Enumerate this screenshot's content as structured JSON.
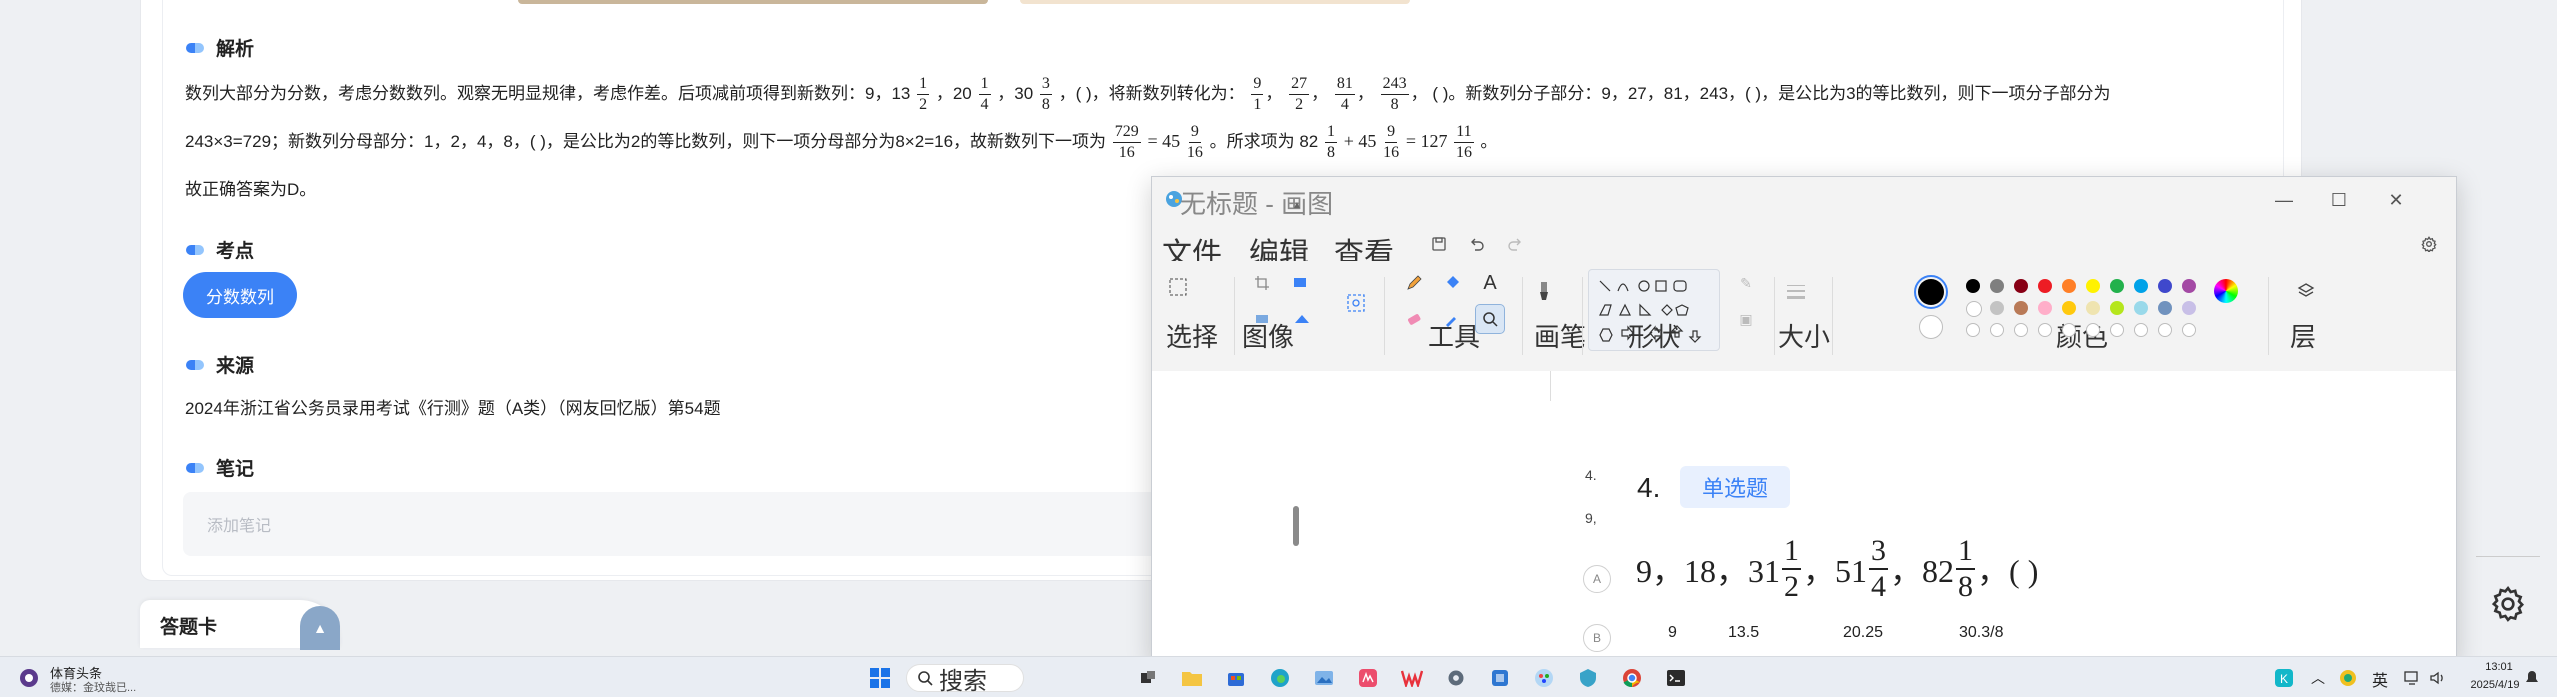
{
  "page": {
    "analysis_title": "解析",
    "analysis_line1_a": "数列大部分为分数，考虑分数数列。观察无明显规律，考虑作差。后项减前项得到新数列：9，13",
    "analysis_line1_b": "，20",
    "analysis_line1_c": "，30",
    "analysis_line1_d": "，( )，将新数列转化为：",
    "analysis_line1_e": "( )。新数列分子部分：9，27，81，243，( )，是公比为3的等比数列，则下一项分子部分为",
    "fracs_line1": [
      {
        "n": "1",
        "d": "2"
      },
      {
        "n": "1",
        "d": "4"
      },
      {
        "n": "3",
        "d": "8"
      },
      {
        "n": "9",
        "d": "1"
      },
      {
        "n": "27",
        "d": "2"
      },
      {
        "n": "81",
        "d": "4"
      },
      {
        "n": "243",
        "d": "8"
      }
    ],
    "analysis_line2_a": "243×3=729；新数列分母部分：1，2，4，8，( )，是公比为2的等比数列，则下一项分母部分为8×2=16，故新数列下一项为",
    "analysis_line2_b": "= 45",
    "analysis_line2_c": "。所求项为 82",
    "analysis_line2_d": "+ 45",
    "analysis_line2_e": "= 127",
    "analysis_line2_f": "。",
    "fracs_line2": [
      {
        "n": "729",
        "d": "16"
      },
      {
        "n": "9",
        "d": "16"
      },
      {
        "n": "1",
        "d": "8"
      },
      {
        "n": "9",
        "d": "16"
      },
      {
        "n": "11",
        "d": "16"
      }
    ],
    "analysis_line3": "故正确答案为D。",
    "knowledge_title": "考点",
    "knowledge_tag": "分数数列",
    "source_title": "来源",
    "source_text": "2024年浙江省公务员录用考试《行测》题（A类）（网友回忆版）第54题",
    "notes_title": "笔记",
    "notes_placeholder": "添加笔记",
    "answer_card": "答题卡"
  },
  "paint": {
    "title": "无标题 - 画图",
    "menu": [
      "文件",
      "编辑",
      "查看"
    ],
    "groups": [
      "选择",
      "图像",
      "工具",
      "画笔",
      "形状",
      "大小",
      "颜色",
      "层"
    ],
    "palette_row1": [
      "#000000",
      "#7f7f7f",
      "#880015",
      "#ed1c24",
      "#ff7f27",
      "#fff200",
      "#22b14c",
      "#00a2e8",
      "#3f48cc",
      "#a349a4"
    ],
    "palette_row2": [
      "#ffffff",
      "#c3c3c3",
      "#b97a57",
      "#ffaec9",
      "#ffc90e",
      "#efe4b0",
      "#b5e61d",
      "#99d9ea",
      "#7092be",
      "#c8bfe7"
    ],
    "canvas": {
      "left_num_4": "4.",
      "left_num_9": "9,",
      "q_num": "4.",
      "q_type": "单选题",
      "seq_a": "9，18，31",
      "seq_b": "，51",
      "seq_c": "，82",
      "seq_d": "，( )",
      "seq_fracs": [
        {
          "n": "1",
          "d": "2"
        },
        {
          "n": "3",
          "d": "4"
        },
        {
          "n": "1",
          "d": "8"
        }
      ],
      "opt_a": "A",
      "opt_b": "B",
      "sub_values": [
        "9",
        "13.5",
        "20.25",
        "30.3/8"
      ]
    }
  },
  "taskbar": {
    "news_title": "体育头条",
    "news_sub": "德媒：金玟哉已...",
    "search": "搜索",
    "tray_lang": "英",
    "time": "13:01",
    "date": "2025/4/19"
  }
}
